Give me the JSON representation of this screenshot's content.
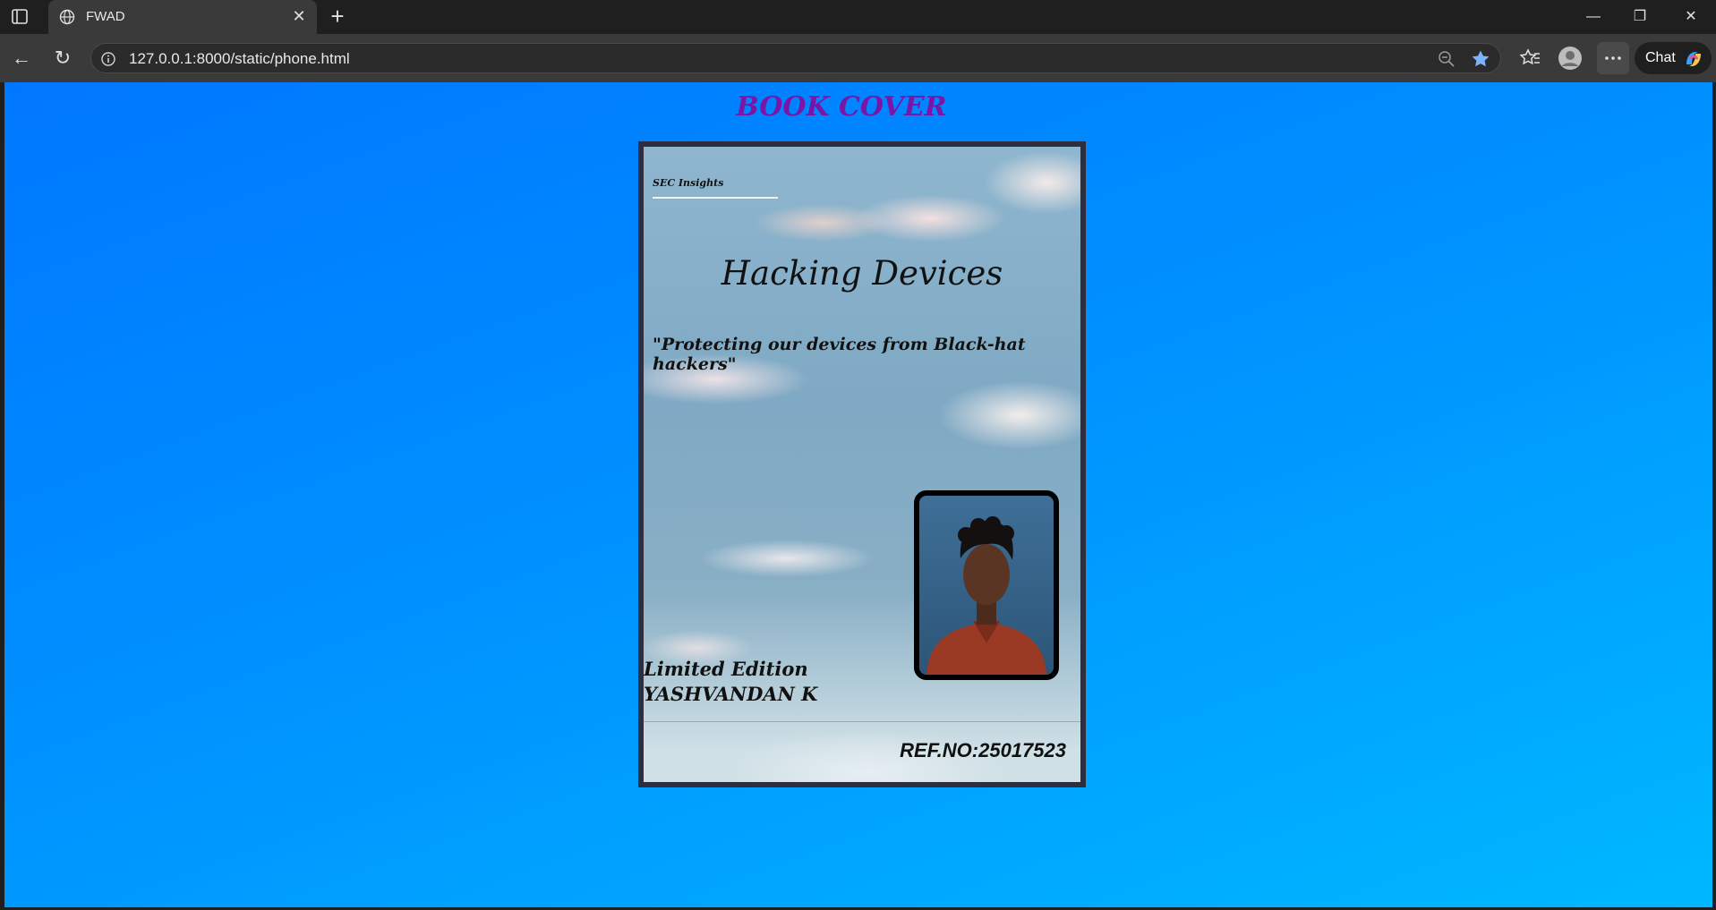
{
  "browser": {
    "tab_title": "FWAD",
    "url": "127.0.0.1:8000/static/phone.html",
    "chat_label": "Chat"
  },
  "page": {
    "heading": "BOOK COVER",
    "cover": {
      "brand": "SEC Insights",
      "title": "Hacking Devices",
      "tagline": "\"Protecting our devices from Black-hat hackers\"",
      "edition": "Limited Edition",
      "author": "YASHVANDAN K",
      "ref": "REF.NO:25017523"
    }
  },
  "colors": {
    "heading": "#7a16a6",
    "page_gradient_start": "#0077ff",
    "page_gradient_end": "#00b8ff",
    "cover_border": "#2e2e3e"
  }
}
